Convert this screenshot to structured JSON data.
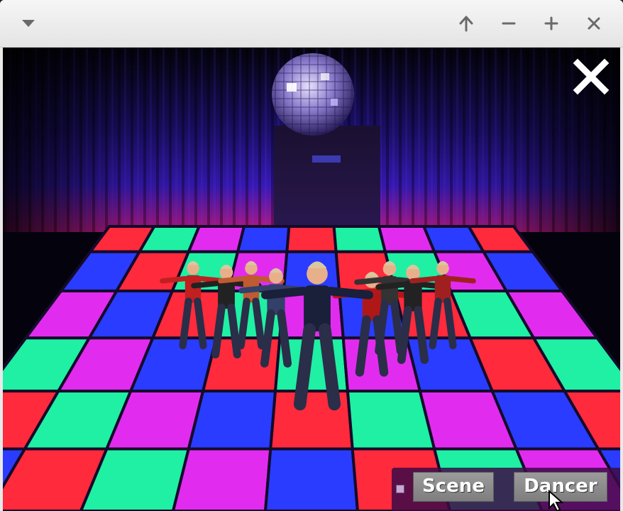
{
  "window": {
    "titlebar": {
      "menu_icon": "chevron-down-icon",
      "buttons": [
        "arrow-up-icon",
        "minimize-icon",
        "maximize-icon",
        "close-icon"
      ]
    }
  },
  "scene": {
    "floor_colors": [
      "#ff2a3c",
      "#1ff0a4",
      "#e12cf0",
      "#2a3cff"
    ],
    "close_icon": "close-x-icon"
  },
  "panel": {
    "scene_label": "Scene",
    "dancer_label": "Dancer",
    "grip_icon": "menu-grip-icon"
  }
}
